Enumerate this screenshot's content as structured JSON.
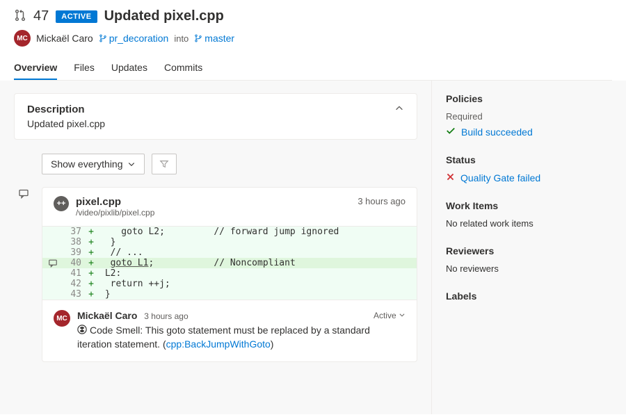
{
  "header": {
    "pr_number": "47",
    "badge": "ACTIVE",
    "title": "Updated pixel.cpp",
    "author_initials": "MC",
    "author_name": "Mickaël Caro",
    "source_branch": "pr_decoration",
    "into": "into",
    "target_branch": "master"
  },
  "tabs": [
    "Overview",
    "Files",
    "Updates",
    "Commits"
  ],
  "description": {
    "heading": "Description",
    "text": "Updated pixel.cpp"
  },
  "filter": {
    "dropdown": "Show everything"
  },
  "file": {
    "name": "pixel.cpp",
    "path": "/video/pixlib/pixel.cpp",
    "time": "3 hours ago",
    "badge": "++",
    "lines": [
      {
        "num": "37",
        "sign": "+",
        "code": "    goto L2;         // forward jump ignored",
        "hl": false
      },
      {
        "num": "38",
        "sign": "+",
        "code": "  }",
        "hl": false
      },
      {
        "num": "39",
        "sign": "+",
        "code": "  // ...",
        "hl": false
      },
      {
        "num": "40",
        "sign": "+",
        "code_pre": "  ",
        "goto_text": "goto L1",
        "code_post": ";           // Noncompliant",
        "hl": true
      },
      {
        "num": "41",
        "sign": "+",
        "code": " L2:",
        "hl": false
      },
      {
        "num": "42",
        "sign": "+",
        "code": "  return ++j;",
        "hl": false
      },
      {
        "num": "43",
        "sign": "+",
        "code": " }",
        "hl": false
      }
    ]
  },
  "comment": {
    "author_initials": "MC",
    "author": "Mickaël Caro",
    "time": "3 hours ago",
    "status": "Active",
    "prefix": "Code Smell: ",
    "text": "This goto statement must be replaced by a standard iteration statement. (",
    "link": "cpp:BackJumpWithGoto",
    "suffix": ")"
  },
  "sidebar": {
    "policies": {
      "title": "Policies",
      "required": "Required",
      "build_label": "Build succeeded"
    },
    "status": {
      "title": "Status",
      "gate_label": "Quality Gate failed"
    },
    "work_items": {
      "title": "Work Items",
      "text": "No related work items"
    },
    "reviewers": {
      "title": "Reviewers",
      "text": "No reviewers"
    },
    "labels": {
      "title": "Labels"
    }
  }
}
